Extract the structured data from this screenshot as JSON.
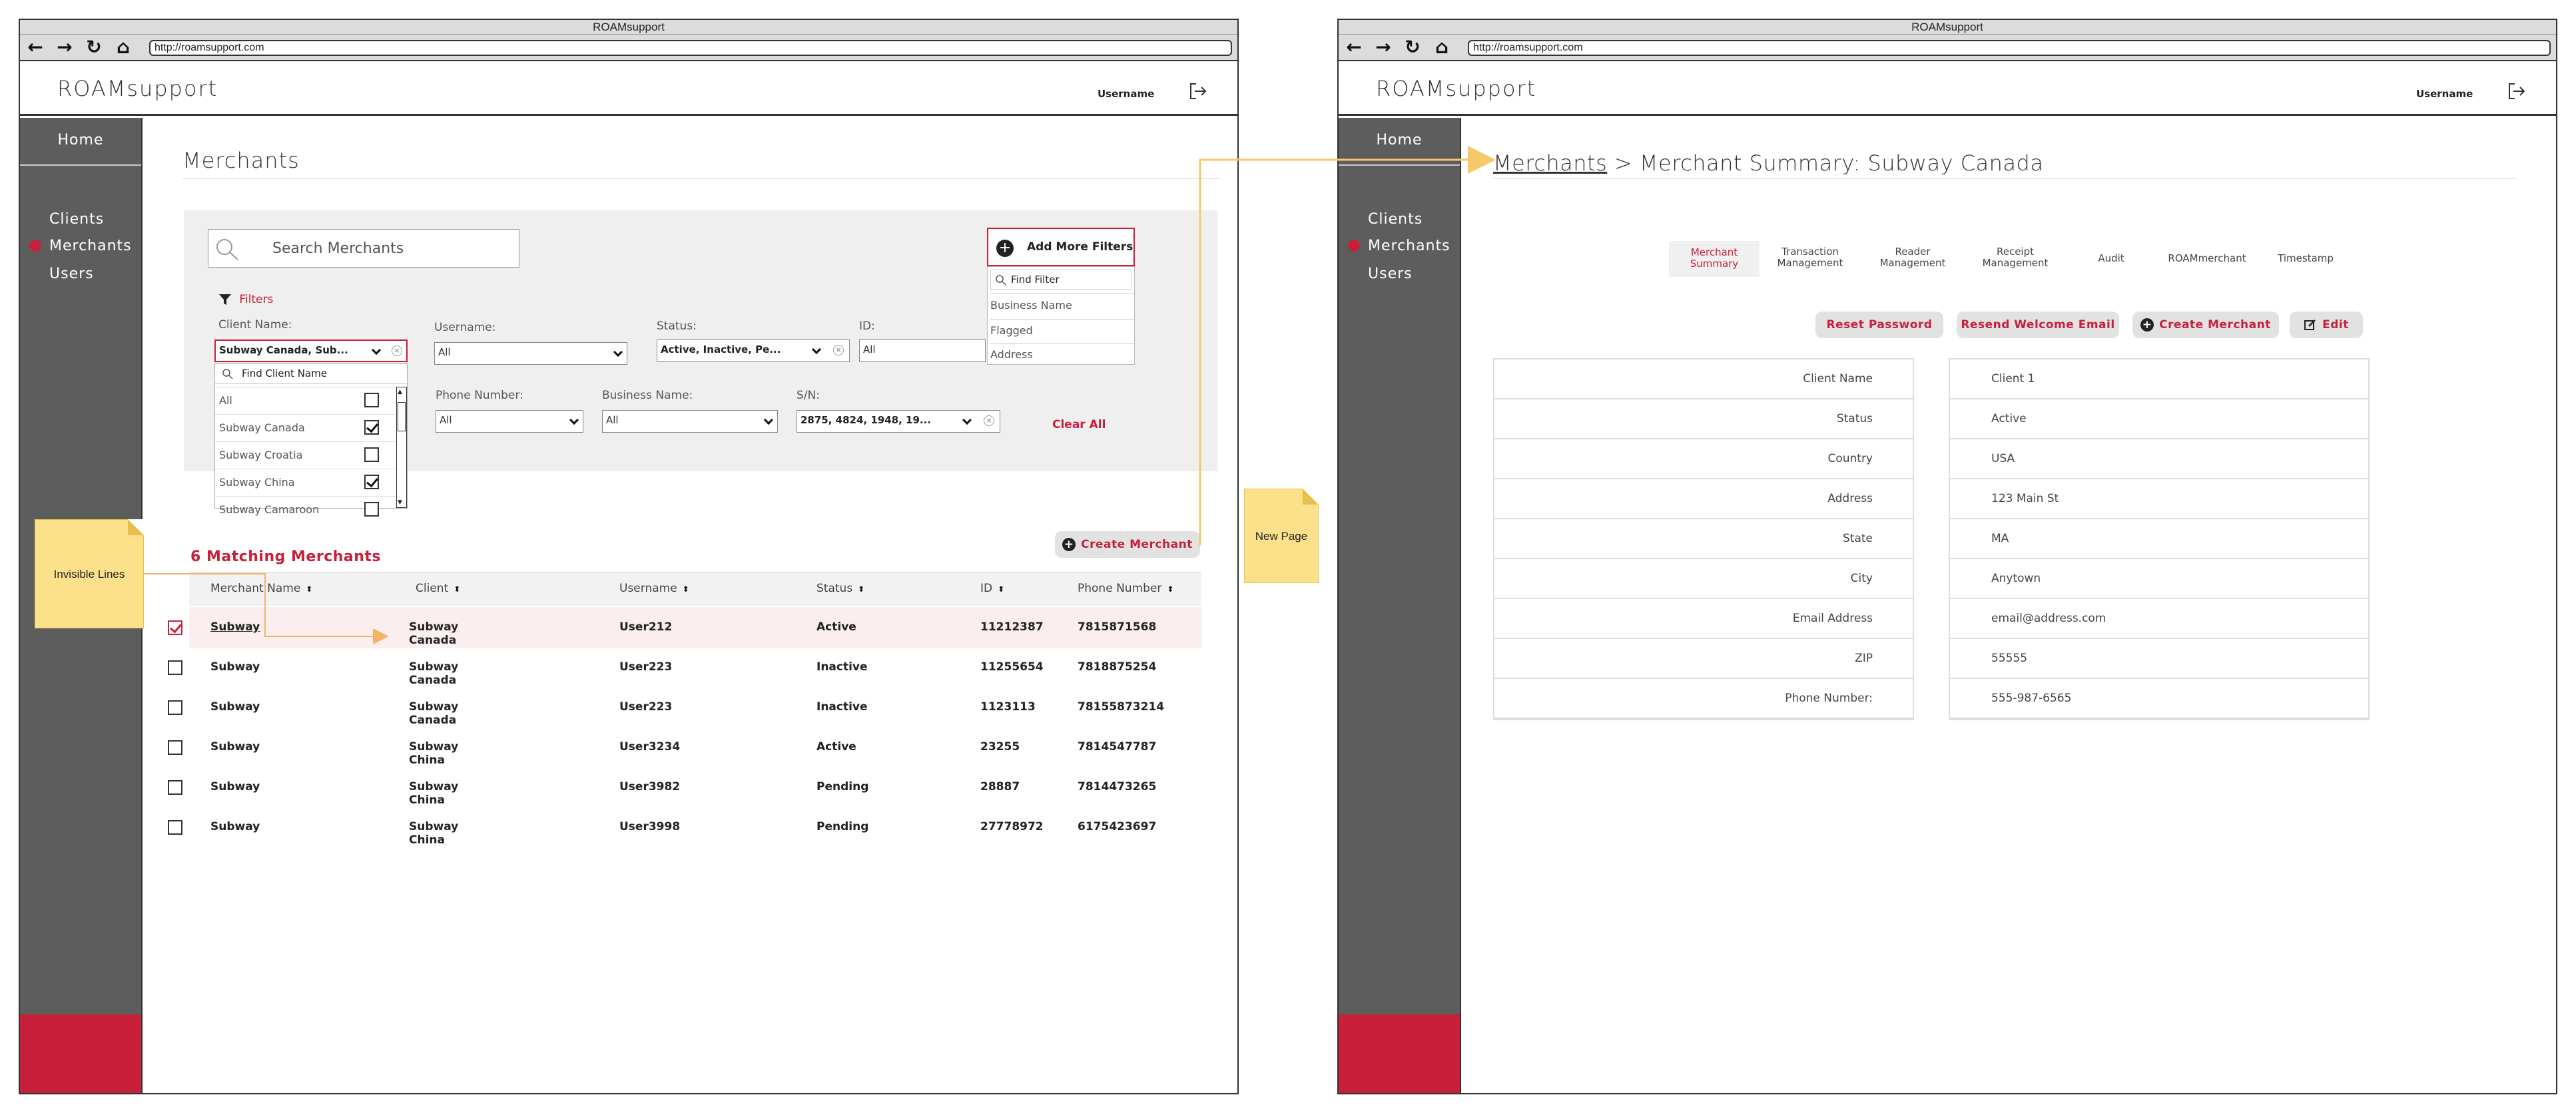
{
  "left_window": {
    "title": "ROAMsupport",
    "url": "http://roamsupport.com",
    "app": {
      "logo": "ROAMsupport",
      "username": "Username"
    },
    "sidebar": {
      "home": "Home",
      "items": [
        "Clients",
        "Merchants",
        "Users"
      ],
      "active": "Merchants"
    },
    "page_title": "Merchants",
    "search_placeholder": "Search Merchants",
    "add_filters": "Add More Filters",
    "find_filter_placeholder": "Find Filter",
    "filter_options": [
      "Business Name",
      "Flagged",
      "Address"
    ],
    "filters_label": "Filters",
    "fields": {
      "client_name": {
        "label": "Client Name:",
        "value": "Subway Canada, Sub..."
      },
      "username": {
        "label": "Username:",
        "value": "All"
      },
      "status": {
        "label": "Status:",
        "value": "Active, Inactive, Pe..."
      },
      "id": {
        "label": "ID:",
        "value": "All"
      },
      "phone": {
        "label": "Phone Number:",
        "value": "All"
      },
      "business": {
        "label": "Business Name:",
        "value": "All"
      },
      "sn": {
        "label": "S/N:",
        "value": "2875, 4824, 1948, 19..."
      }
    },
    "find_client_placeholder": "Find Client Name",
    "client_options": [
      {
        "label": "All",
        "checked": false
      },
      {
        "label": "Subway Canada",
        "checked": true
      },
      {
        "label": "Subway Croatia",
        "checked": false
      },
      {
        "label": "Subway China",
        "checked": true
      },
      {
        "label": "Subway Camaroon",
        "checked": false
      }
    ],
    "clear_all": "Clear All",
    "matching": "6 Matching Merchants",
    "create_merchant": "Create Merchant",
    "columns": [
      "Merchant Name",
      "Client",
      "Username",
      "Status",
      "ID",
      "Phone Number"
    ],
    "rows": [
      [
        "Subway",
        "Subway Canada",
        "User212",
        "Active",
        "11212387",
        "7815871568"
      ],
      [
        "Subway",
        "Subway Canada",
        "User223",
        "Inactive",
        "11255654",
        "7818875254"
      ],
      [
        "Subway",
        "Subway Canada",
        "User223",
        "Inactive",
        "1123113",
        "78155873214"
      ],
      [
        "Subway",
        "Subway China",
        "User3234",
        "Active",
        "23255",
        "7814547787"
      ],
      [
        "Subway",
        "Subway China",
        "User3982",
        "Pending",
        "28887",
        "7814473265"
      ],
      [
        "Subway",
        "Subway China",
        "User3998",
        "Pending",
        "27778972",
        "6175423697"
      ]
    ]
  },
  "notes": {
    "invisible": "Invisible Lines",
    "new_page": "New Page"
  },
  "right_window": {
    "title": "ROAMsupport",
    "url": "http://roamsupport.com",
    "app": {
      "logo": "ROAMsupport",
      "username": "Username"
    },
    "sidebar": {
      "home": "Home",
      "items": [
        "Clients",
        "Merchants",
        "Users"
      ],
      "active": "Merchants"
    },
    "breadcrumb": {
      "link": "Merchants",
      "current": "> Merchant Summary: Subway Canada"
    },
    "tabs": [
      {
        "label": "Merchant Summary",
        "lines": [
          "Merchant",
          "Summary"
        ],
        "active": true
      },
      {
        "label": "Transaction Management",
        "lines": [
          "Transaction",
          "Management"
        ],
        "active": false
      },
      {
        "label": "Reader Management",
        "lines": [
          "Reader",
          "Management"
        ],
        "active": false
      },
      {
        "label": "Receipt Management",
        "lines": [
          "Receipt",
          "Management"
        ],
        "active": false
      },
      {
        "label": "Audit",
        "lines": [
          "Audit"
        ],
        "active": false
      },
      {
        "label": "ROAMmerchant",
        "lines": [
          "ROAMmerchant"
        ],
        "active": false
      },
      {
        "label": "Timestamp",
        "lines": [
          "Timestamp"
        ],
        "active": false
      }
    ],
    "buttons": {
      "reset": "Reset Password",
      "resend": "Resend Welcome Email",
      "create": "Create Merchant",
      "edit": "Edit"
    },
    "details": [
      {
        "key": "Client Name",
        "value": "Client 1"
      },
      {
        "key": "Status",
        "value": "Active"
      },
      {
        "key": "Country",
        "value": "USA"
      },
      {
        "key": "Address",
        "value": "123 Main St"
      },
      {
        "key": "State",
        "value": "MA"
      },
      {
        "key": "City",
        "value": "Anytown"
      },
      {
        "key": "Email Address",
        "value": "email@address.com"
      },
      {
        "key": "ZIP",
        "value": "55555"
      },
      {
        "key": "Phone Number:",
        "value": "555-987-6565"
      }
    ]
  },
  "colors": {
    "accent": "#c8203a",
    "sidebar": "#5d5d5d",
    "note": "#fde08a",
    "arrow": "#f5c96a"
  }
}
